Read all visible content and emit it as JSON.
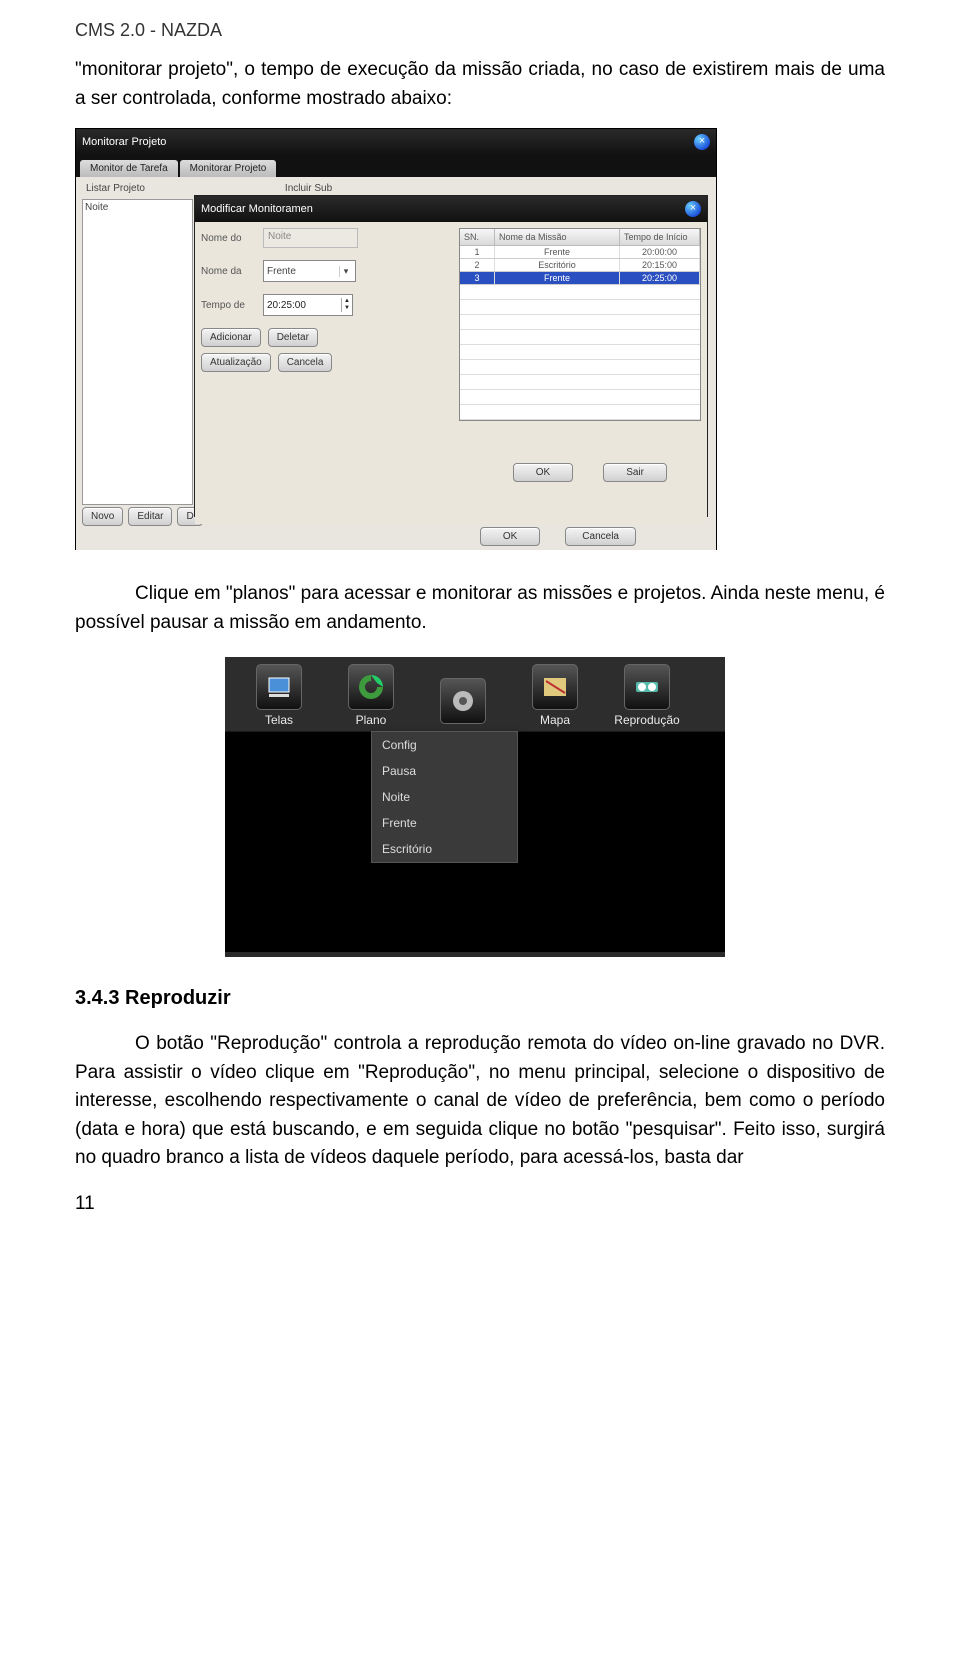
{
  "header": "CMS 2.0 - NAZDA",
  "para1": "\"monitorar projeto\", o tempo de execução da missão criada, no caso de existirem mais de uma a ser controlada, conforme mostrado abaixo:",
  "para2": "Clique em \"planos\" para acessar e monitorar as missões e projetos. Ainda neste menu, é possível pausar a missão em andamento.",
  "section_title": "3.4.3 Reproduzir",
  "para3": "O botão \"Reprodução\" controla a reprodução remota do vídeo on-line gravado no DVR. Para assistir o vídeo clique em \"Reprodução\", no menu principal, selecione o dispositivo de interesse, escolhendo respectivamente o canal de vídeo de preferência, bem como o período (data e hora) que está buscando, e em seguida clique no botão \"pesquisar\". Feito isso, surgirá no quadro branco a lista de vídeos daquele período, para acessá-los, basta dar",
  "page_number": "11",
  "shot1": {
    "outer_title": "Monitorar Projeto",
    "tabs": [
      "Monitor de Tarefa",
      "Monitorar Projeto"
    ],
    "subheaders": [
      "Listar Projeto",
      "Incluir Sub"
    ],
    "left_item": "Noite",
    "bottom_buttons": [
      "Novo",
      "Editar",
      "D"
    ],
    "inner_title": "Modificar Monitoramen",
    "form": {
      "label_nome_do": "Nome do",
      "value_nome_do": "Noite",
      "label_nome_da": "Nome da",
      "value_nome_da": "Frente",
      "label_tempo_de": "Tempo de",
      "value_tempo_de": "20:25:00"
    },
    "buttons": {
      "adicionar": "Adicionar",
      "deletar": "Deletar",
      "atualizacao": "Atualização",
      "cancela": "Cancela",
      "ok": "OK",
      "sair": "Sair",
      "outer_ok": "OK",
      "outer_cancela": "Cancela"
    },
    "table": {
      "headers": [
        "SN.",
        "Nome da Missão",
        "Tempo de Início"
      ],
      "rows": [
        {
          "sn": "1",
          "nome": "Frente",
          "tempo": "20:00:00"
        },
        {
          "sn": "2",
          "nome": "Escritório",
          "tempo": "20:15:00"
        },
        {
          "sn": "3",
          "nome": "Frente",
          "tempo": "20:25:00"
        }
      ]
    }
  },
  "shot2": {
    "tools": [
      {
        "label": "Telas",
        "icon": "telas"
      },
      {
        "label": "Plano",
        "icon": "plano"
      },
      {
        "label": "",
        "icon": "config"
      },
      {
        "label": "Mapa",
        "icon": "mapa"
      },
      {
        "label": "Reprodução",
        "icon": "reproducao"
      }
    ],
    "menu": [
      "Config",
      "Pausa",
      "Noite",
      "Frente",
      "Escritório"
    ]
  }
}
